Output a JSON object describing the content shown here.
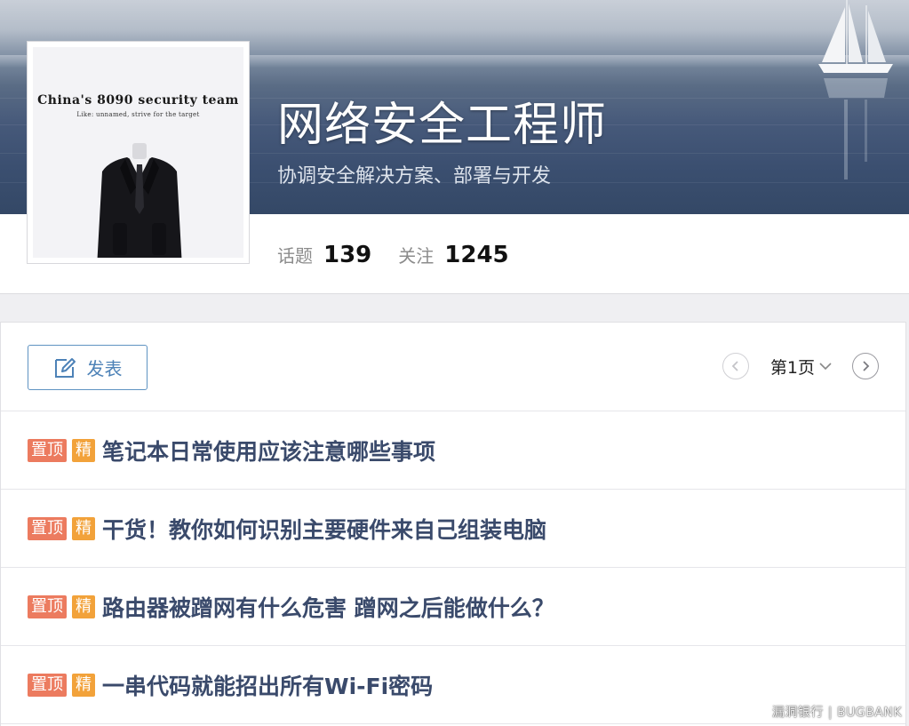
{
  "group": {
    "title": "网络安全工程师",
    "subtitle": "协调安全解决方案、部署与开发",
    "avatar": {
      "heading": "China's 8090 security team",
      "tagline": "Like: unnamed, strive for the target"
    },
    "stats": [
      {
        "label": "话题",
        "value": "139"
      },
      {
        "label": "关注",
        "value": "1245"
      }
    ]
  },
  "toolbar": {
    "post_label": "发表",
    "pager": {
      "current_page": "第1页"
    }
  },
  "topics": [
    {
      "pinned": "置顶",
      "featured": "精",
      "title": "笔记本日常使用应该注意哪些事项"
    },
    {
      "pinned": "置顶",
      "featured": "精",
      "title": "干货！教你如何识别主要硬件来自己组装电脑"
    },
    {
      "pinned": "置顶",
      "featured": "精",
      "title": "路由器被蹭网有什么危害 蹭网之后能做什么？"
    },
    {
      "pinned": "置顶",
      "featured": "精",
      "title": "一串代码就能招出所有Wi-Fi密码"
    }
  ],
  "watermark": "漏洞银行 | BUGBANK",
  "colors": {
    "accent_blue": "#4d82b7",
    "badge_pinned": "#ec7b5f",
    "badge_featured": "#f2a23a",
    "topic_title": "#3a4a6b"
  },
  "icons": {
    "post_button": "edit-icon",
    "pager_prev": "chevron-left-icon",
    "pager_next": "chevron-right-icon",
    "page_dropdown": "chevron-down-icon"
  }
}
